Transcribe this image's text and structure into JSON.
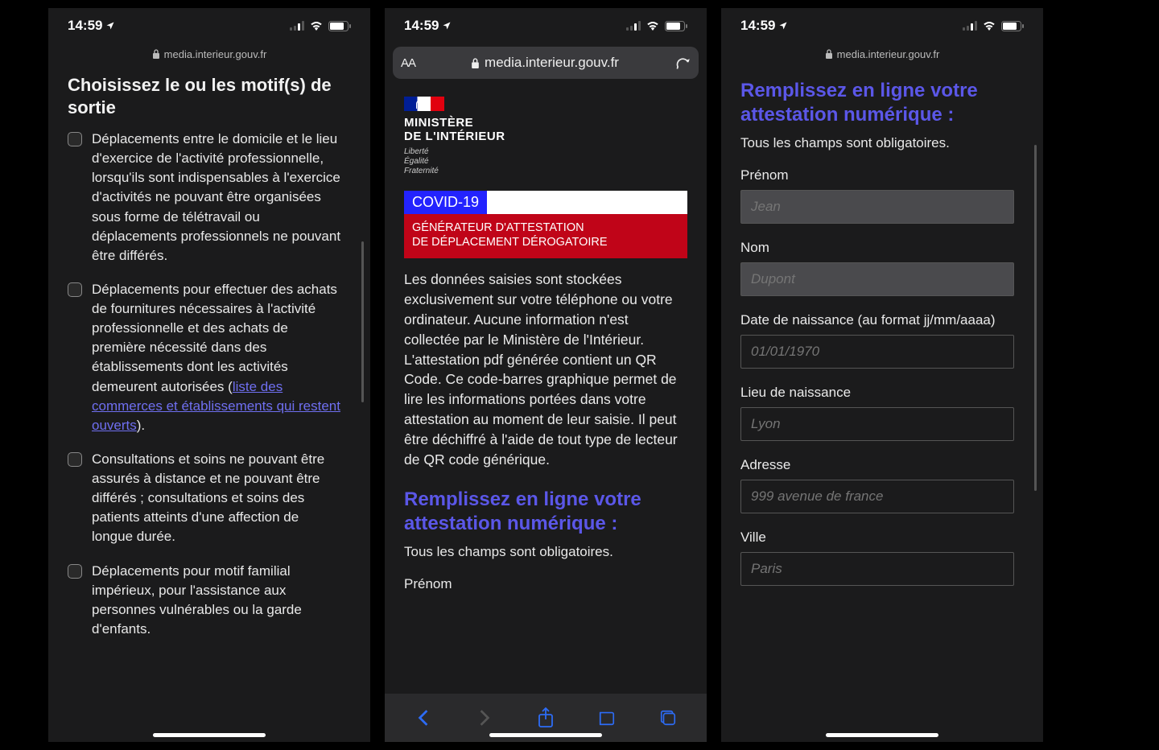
{
  "status": {
    "time": "14:59",
    "domain_small": "media.interieur.gouv.fr",
    "domain_big": "media.interieur.gouv.fr",
    "aa": "AA"
  },
  "screen1": {
    "title": "Choisissez le ou les motif(s) de sortie",
    "motifs": [
      "Déplacements entre le domicile et le lieu d'exercice de l'activité professionnelle, lorsqu'ils sont indispensables à l'exercice d'activités ne pouvant être organisées sous forme de télétravail ou déplacements professionnels ne pouvant être différés.",
      "Déplacements pour effectuer des achats de fournitures nécessaires à l'activité professionnelle et des achats de première nécessité dans des établissements dont les activités demeurent autorisées (",
      "Consultations et soins ne pouvant être assurés à distance et ne pouvant être différés ; consultations et soins des patients atteints d'une affection de longue durée.",
      "Déplacements pour motif familial impérieux, pour l'assistance aux personnes vulnérables ou la garde d'enfants."
    ],
    "link_text": "liste des commerces et établissements qui restent ouverts",
    "link_after": ")."
  },
  "screen2": {
    "ministry_line1": "MINISTÈRE",
    "ministry_line2": "DE L'INTÉRIEUR",
    "motto1": "Liberté",
    "motto2": "Égalité",
    "motto3": "Fraternité",
    "covid_badge": "COVID-19",
    "covid_line1": "GÉNÉRATEUR D'ATTESTATION",
    "covid_line2": "DE DÉPLACEMENT DÉROGATOIRE",
    "intro": "Les données saisies sont stockées exclusivement sur votre téléphone ou votre ordinateur. Aucune information n'est collectée par le Ministère de l'Intérieur. L'attestation pdf générée contient un QR Code. Ce code-barres graphique permet de lire les informations portées dans votre attestation au moment de leur saisie. Il peut être déchiffré à l'aide de tout type de lecteur de QR code générique.",
    "form_heading": "Remplissez en ligne votre attestation numérique :",
    "form_sub": "Tous les champs sont obligatoires.",
    "prenom_label": "Prénom"
  },
  "screen3": {
    "form_heading": "Remplissez en ligne votre attestation numérique :",
    "form_sub": "Tous les champs sont obligatoires.",
    "fields": {
      "prenom": {
        "label": "Prénom",
        "placeholder": "Jean"
      },
      "nom": {
        "label": "Nom",
        "placeholder": "Dupont"
      },
      "dob": {
        "label": "Date de naissance (au format jj/mm/aaaa)",
        "placeholder": "01/01/1970"
      },
      "lieu": {
        "label": "Lieu de naissance",
        "placeholder": "Lyon"
      },
      "adresse": {
        "label": "Adresse",
        "placeholder": "999 avenue de france"
      },
      "ville": {
        "label": "Ville",
        "placeholder": "Paris"
      }
    }
  }
}
